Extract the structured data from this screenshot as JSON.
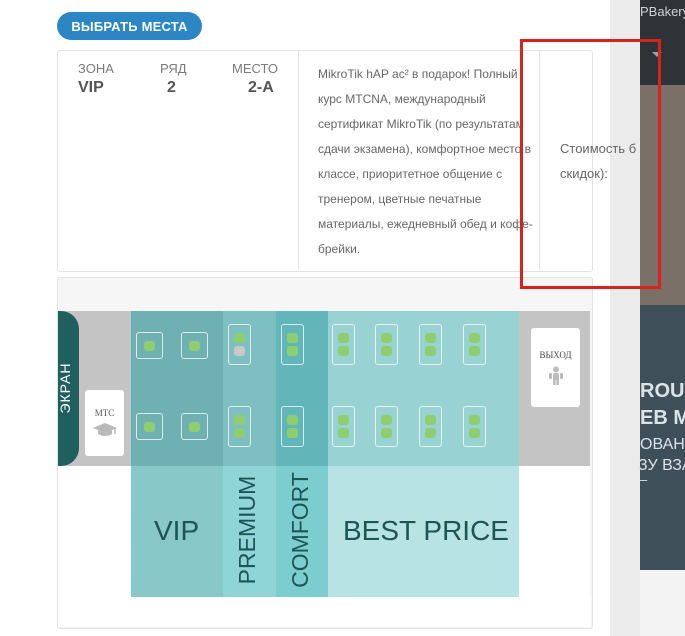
{
  "background": {
    "plugin_label": "PBakery",
    "promo_lines": [
      "ROUT",
      "EB M",
      "ОВАН",
      "ЗУ ВЗА",
      "–"
    ]
  },
  "choose_button": {
    "label": "ВЫБРАТЬ МЕСТА",
    "color": "#2d86c4"
  },
  "selection": {
    "zone_label": "ЗОНА",
    "zone_value": "VIP",
    "row_label": "РЯД",
    "row_value": "2",
    "seat_label": "МЕСТО",
    "seat_value": "2-А"
  },
  "description": "MikroTik hAP ac² в подарок! Полный курс MTCNA, международный сертификат MikroTik (по результатам сдачи экзамена), комфортное место в классе, приоритетное общение с тренером, цветные печатные материалы, ежедневный обед и кофе-брейки.",
  "price": {
    "label_line1": "Стоимость б",
    "label_line2": "скидок):"
  },
  "seat_map": {
    "screen_label": "ЭКРАН",
    "mtc_label": "MTC",
    "exit_label": "ВЫХОД",
    "zones": [
      {
        "name": "VIP",
        "color": "#88c8c9"
      },
      {
        "name": "PREMIUM",
        "color": "#8fd4d6"
      },
      {
        "name": "COMFORT",
        "color": "#7ccdd0"
      },
      {
        "name": "BEST PRICE",
        "color": "#b8e3e4"
      }
    ],
    "seat_available_color": "#8fce6e",
    "seat_taken_color": "#c8c8c8"
  }
}
